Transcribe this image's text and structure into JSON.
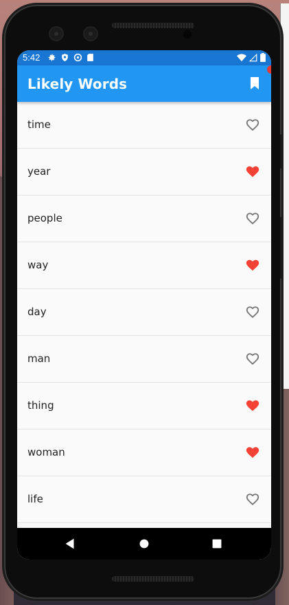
{
  "status_bar": {
    "time": "5:42",
    "left_icons": [
      "settings-icon",
      "shield-icon",
      "sync-icon",
      "sd-card-icon"
    ],
    "right_icons": [
      "wifi-icon",
      "signal-icon",
      "battery-icon"
    ]
  },
  "app_bar": {
    "title": "Likely Words",
    "action_icon": "bookmark-icon",
    "color": "#2196f3"
  },
  "words": [
    {
      "word": "time",
      "favorited": false
    },
    {
      "word": "year",
      "favorited": true
    },
    {
      "word": "people",
      "favorited": false
    },
    {
      "word": "way",
      "favorited": true
    },
    {
      "word": "day",
      "favorited": false
    },
    {
      "word": "man",
      "favorited": false
    },
    {
      "word": "thing",
      "favorited": true
    },
    {
      "word": "woman",
      "favorited": true
    },
    {
      "word": "life",
      "favorited": false
    }
  ],
  "colors": {
    "heart_filled": "#f44336",
    "heart_outline": "#757575",
    "status_bar": "#1976d2"
  },
  "nav_bar": {
    "buttons": [
      "back-icon",
      "home-icon",
      "recents-icon"
    ]
  }
}
